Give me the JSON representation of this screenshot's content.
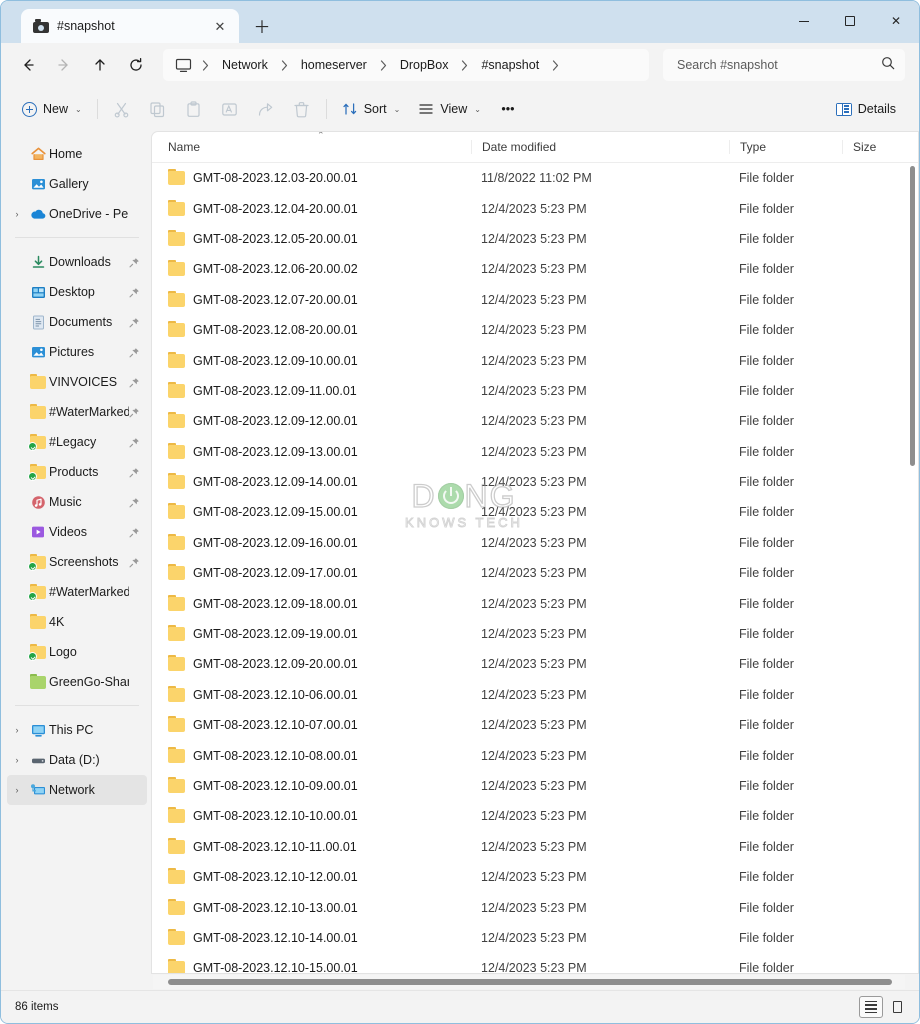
{
  "window": {
    "tab_title": "#snapshot",
    "tab_icon": "snapshot-camera-icon",
    "close_tab_label": "✕",
    "new_tab_label": "＋",
    "minimize_label": "minimize",
    "maximize_label": "maximize",
    "close_label": "✕"
  },
  "nav": {
    "back_label": "Back",
    "forward_label": "Forward",
    "up_label": "Up",
    "refresh_label": "Refresh",
    "breadcrumbs": [
      "Network",
      "homeserver",
      "DropBox",
      "#snapshot"
    ],
    "separator": "›"
  },
  "search": {
    "placeholder": "Search #snapshot"
  },
  "toolbar": {
    "new_label": "New",
    "cut_label": "Cut",
    "copy_label": "Copy",
    "paste_label": "Paste",
    "rename_label": "Rename",
    "share_label": "Share",
    "delete_label": "Delete",
    "sort_label": "Sort",
    "view_label": "View",
    "more_label": "•••",
    "details_label": "Details",
    "chevron": "⌄"
  },
  "sidebar": {
    "groups": [
      {
        "items": [
          {
            "label": "Home",
            "icon": "home-icon",
            "expander": false,
            "pinned": false
          },
          {
            "label": "Gallery",
            "icon": "gallery-icon",
            "expander": false,
            "pinned": false
          },
          {
            "label": "OneDrive - Persona",
            "icon": "onedrive-icon",
            "expander": true,
            "pinned": false
          }
        ]
      },
      {
        "items": [
          {
            "label": "Downloads",
            "icon": "downloads-icon",
            "expander": false,
            "pinned": true
          },
          {
            "label": "Desktop",
            "icon": "desktop-icon",
            "expander": false,
            "pinned": true
          },
          {
            "label": "Documents",
            "icon": "documents-icon",
            "expander": false,
            "pinned": true
          },
          {
            "label": "Pictures",
            "icon": "pictures-icon",
            "expander": false,
            "pinned": true
          },
          {
            "label": "VINVOICES",
            "icon": "folder-yellow-icon",
            "expander": false,
            "pinned": true
          },
          {
            "label": "#WaterMarked",
            "icon": "folder-yellow-icon",
            "expander": false,
            "pinned": true
          },
          {
            "label": "#Legacy",
            "icon": "folder-synced-icon",
            "expander": false,
            "pinned": true
          },
          {
            "label": "Products",
            "icon": "folder-synced-icon",
            "expander": false,
            "pinned": true
          },
          {
            "label": "Music",
            "icon": "music-icon",
            "expander": false,
            "pinned": true
          },
          {
            "label": "Videos",
            "icon": "videos-icon",
            "expander": false,
            "pinned": true
          },
          {
            "label": "Screenshots",
            "icon": "folder-synced-icon",
            "expander": false,
            "pinned": true
          },
          {
            "label": "#WaterMarked",
            "icon": "folder-synced-icon",
            "expander": false,
            "pinned": false
          },
          {
            "label": "4K",
            "icon": "folder-yellow-icon",
            "expander": false,
            "pinned": false
          },
          {
            "label": "Logo",
            "icon": "folder-synced-icon",
            "expander": false,
            "pinned": false
          },
          {
            "label": "GreenGo-Shared",
            "icon": "folder-green-icon",
            "expander": false,
            "pinned": false
          }
        ]
      },
      {
        "items": [
          {
            "label": "This PC",
            "icon": "this-pc-icon",
            "expander": true,
            "pinned": false
          },
          {
            "label": "Data (D:)",
            "icon": "drive-icon",
            "expander": true,
            "pinned": false
          },
          {
            "label": "Network",
            "icon": "network-icon",
            "expander": true,
            "pinned": false,
            "selected": true
          }
        ]
      }
    ]
  },
  "filelist": {
    "columns": [
      "Name",
      "Date modified",
      "Type",
      "Size"
    ],
    "sort_column": "Name",
    "sort_direction": "ascending",
    "sort_caret": "⌃",
    "rows": [
      {
        "name": "GMT-08-2023.12.03-20.00.01",
        "date": "11/8/2022 11:02 PM",
        "type": "File folder",
        "size": ""
      },
      {
        "name": "GMT-08-2023.12.04-20.00.01",
        "date": "12/4/2023 5:23 PM",
        "type": "File folder",
        "size": ""
      },
      {
        "name": "GMT-08-2023.12.05-20.00.01",
        "date": "12/4/2023 5:23 PM",
        "type": "File folder",
        "size": ""
      },
      {
        "name": "GMT-08-2023.12.06-20.00.02",
        "date": "12/4/2023 5:23 PM",
        "type": "File folder",
        "size": ""
      },
      {
        "name": "GMT-08-2023.12.07-20.00.01",
        "date": "12/4/2023 5:23 PM",
        "type": "File folder",
        "size": ""
      },
      {
        "name": "GMT-08-2023.12.08-20.00.01",
        "date": "12/4/2023 5:23 PM",
        "type": "File folder",
        "size": ""
      },
      {
        "name": "GMT-08-2023.12.09-10.00.01",
        "date": "12/4/2023 5:23 PM",
        "type": "File folder",
        "size": ""
      },
      {
        "name": "GMT-08-2023.12.09-11.00.01",
        "date": "12/4/2023 5:23 PM",
        "type": "File folder",
        "size": ""
      },
      {
        "name": "GMT-08-2023.12.09-12.00.01",
        "date": "12/4/2023 5:23 PM",
        "type": "File folder",
        "size": ""
      },
      {
        "name": "GMT-08-2023.12.09-13.00.01",
        "date": "12/4/2023 5:23 PM",
        "type": "File folder",
        "size": ""
      },
      {
        "name": "GMT-08-2023.12.09-14.00.01",
        "date": "12/4/2023 5:23 PM",
        "type": "File folder",
        "size": ""
      },
      {
        "name": "GMT-08-2023.12.09-15.00.01",
        "date": "12/4/2023 5:23 PM",
        "type": "File folder",
        "size": ""
      },
      {
        "name": "GMT-08-2023.12.09-16.00.01",
        "date": "12/4/2023 5:23 PM",
        "type": "File folder",
        "size": ""
      },
      {
        "name": "GMT-08-2023.12.09-17.00.01",
        "date": "12/4/2023 5:23 PM",
        "type": "File folder",
        "size": ""
      },
      {
        "name": "GMT-08-2023.12.09-18.00.01",
        "date": "12/4/2023 5:23 PM",
        "type": "File folder",
        "size": ""
      },
      {
        "name": "GMT-08-2023.12.09-19.00.01",
        "date": "12/4/2023 5:23 PM",
        "type": "File folder",
        "size": ""
      },
      {
        "name": "GMT-08-2023.12.09-20.00.01",
        "date": "12/4/2023 5:23 PM",
        "type": "File folder",
        "size": ""
      },
      {
        "name": "GMT-08-2023.12.10-06.00.01",
        "date": "12/4/2023 5:23 PM",
        "type": "File folder",
        "size": ""
      },
      {
        "name": "GMT-08-2023.12.10-07.00.01",
        "date": "12/4/2023 5:23 PM",
        "type": "File folder",
        "size": ""
      },
      {
        "name": "GMT-08-2023.12.10-08.00.01",
        "date": "12/4/2023 5:23 PM",
        "type": "File folder",
        "size": ""
      },
      {
        "name": "GMT-08-2023.12.10-09.00.01",
        "date": "12/4/2023 5:23 PM",
        "type": "File folder",
        "size": ""
      },
      {
        "name": "GMT-08-2023.12.10-10.00.01",
        "date": "12/4/2023 5:23 PM",
        "type": "File folder",
        "size": ""
      },
      {
        "name": "GMT-08-2023.12.10-11.00.01",
        "date": "12/4/2023 5:23 PM",
        "type": "File folder",
        "size": ""
      },
      {
        "name": "GMT-08-2023.12.10-12.00.01",
        "date": "12/4/2023 5:23 PM",
        "type": "File folder",
        "size": ""
      },
      {
        "name": "GMT-08-2023.12.10-13.00.01",
        "date": "12/4/2023 5:23 PM",
        "type": "File folder",
        "size": ""
      },
      {
        "name": "GMT-08-2023.12.10-14.00.01",
        "date": "12/4/2023 5:23 PM",
        "type": "File folder",
        "size": ""
      },
      {
        "name": "GMT-08-2023.12.10-15.00.01",
        "date": "12/4/2023 5:23 PM",
        "type": "File folder",
        "size": ""
      }
    ]
  },
  "watermark": {
    "top_text_a": "D",
    "top_text_b": "NG",
    "bottom_text": "KNOWS TECH"
  },
  "statusbar": {
    "item_count": "86 items",
    "details_view_label": "Details view",
    "thumbnail_view_label": "Large icons view"
  },
  "colors": {
    "accent": "#2b6fbb",
    "titlebar": "#cfe0ee",
    "folder_yellow": "#fbd46b",
    "sync_green": "#22a447"
  }
}
